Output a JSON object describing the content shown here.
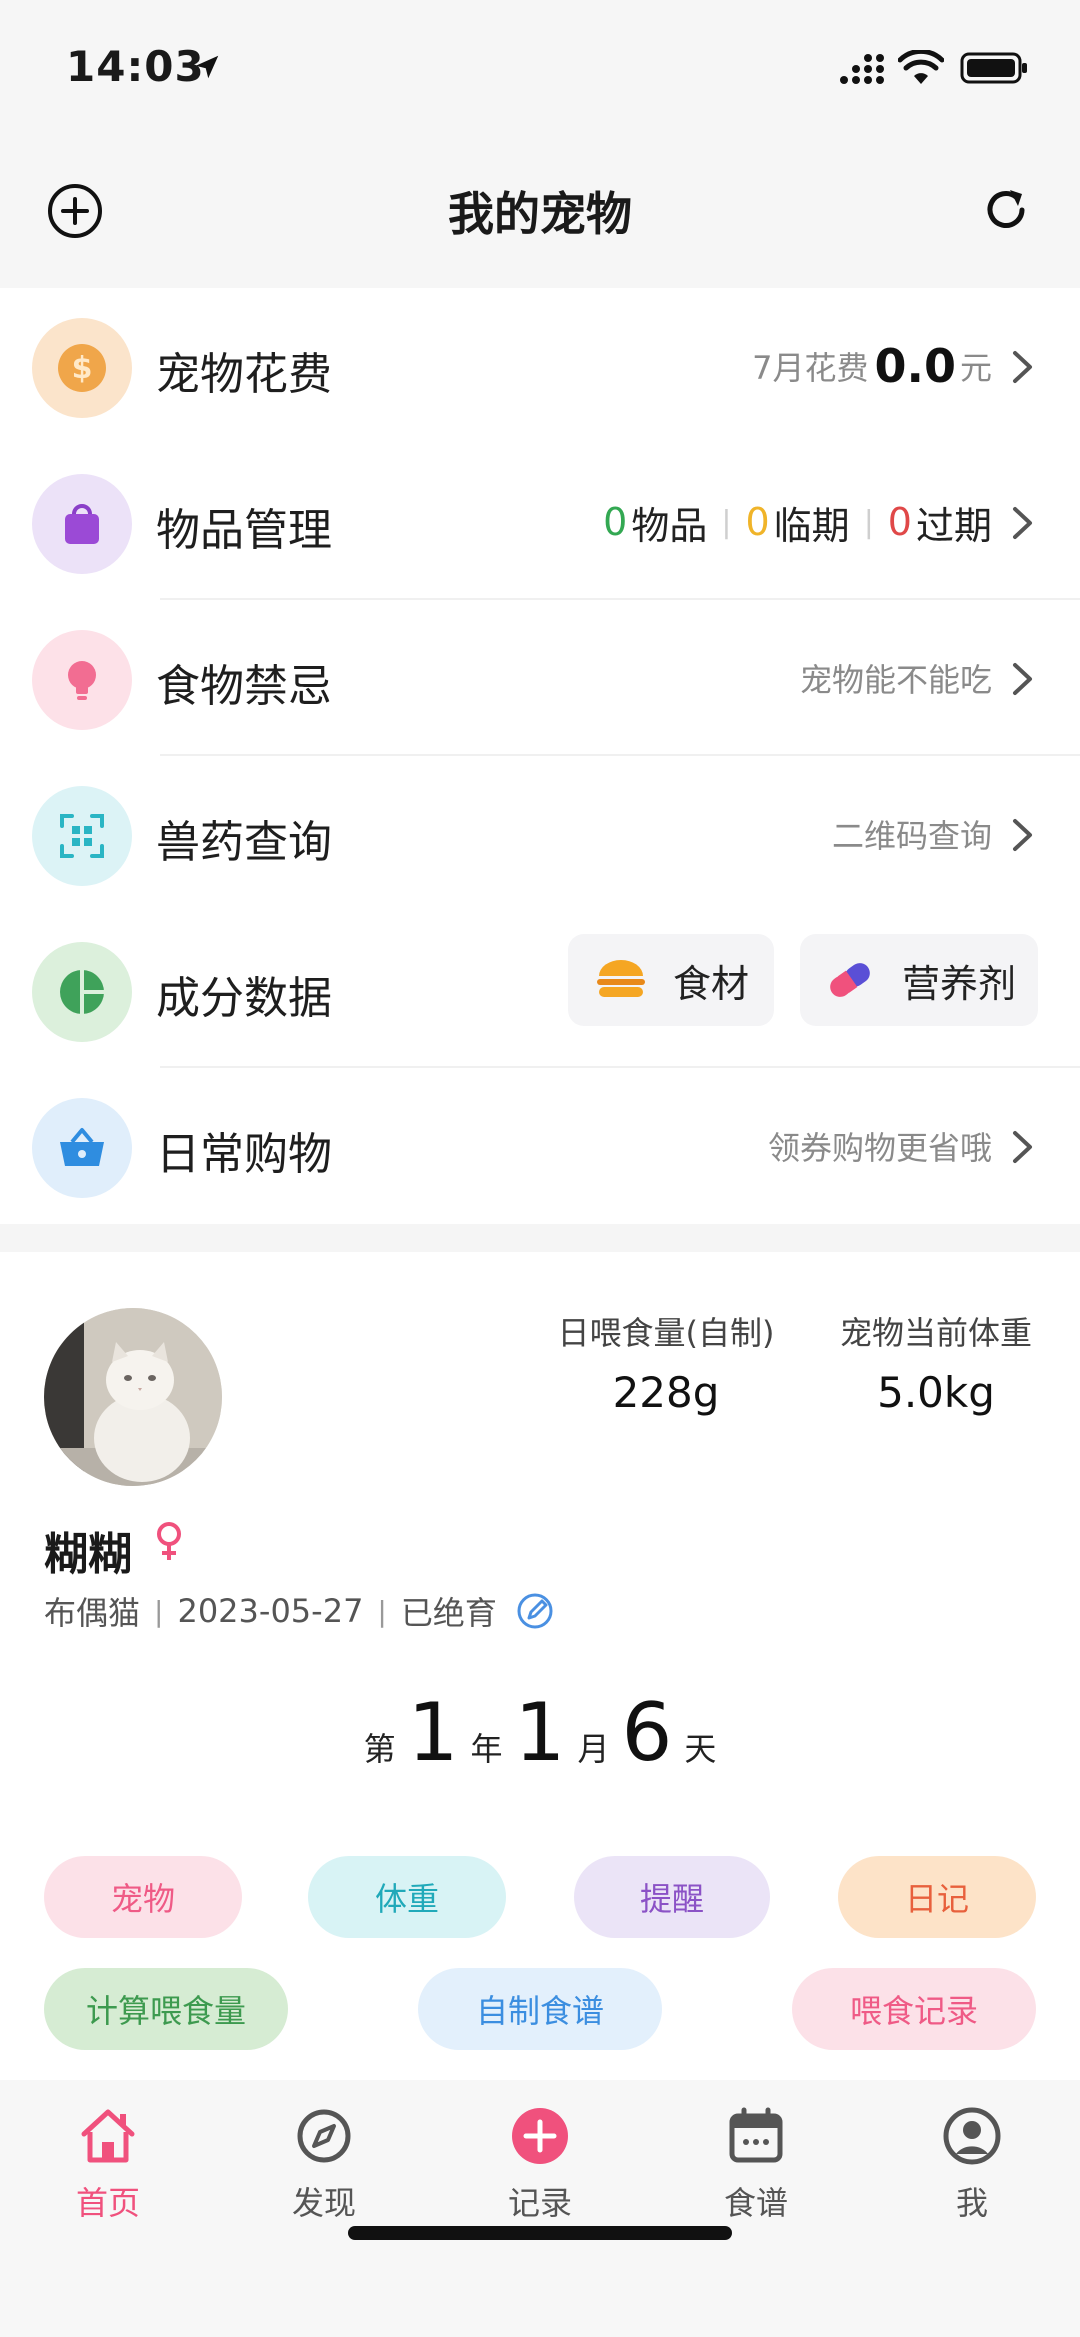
{
  "status_bar": {
    "time": "14:03"
  },
  "nav": {
    "title": "我的宠物"
  },
  "tools": {
    "expense": {
      "label": "宠物花费",
      "month_prefix": "7月花费",
      "value": "0.0",
      "unit": "元"
    },
    "items": {
      "label": "物品管理",
      "count_items": "0",
      "items_label": "物品",
      "count_expiring": "0",
      "expiring_label": "临期",
      "count_expired": "0",
      "expired_label": "过期"
    },
    "food_taboo": {
      "label": "食物禁忌",
      "hint": "宠物能不能吃"
    },
    "vet_drug": {
      "label": "兽药查询",
      "hint": "二维码查询"
    },
    "ingredients": {
      "label": "成分数据",
      "chip_food": "食材",
      "chip_supplement": "营养剂"
    },
    "shopping": {
      "label": "日常购物",
      "hint": "领券购物更省哦"
    }
  },
  "pet": {
    "daily_food_label": "日喂食量(自制)",
    "daily_food_value": "228g",
    "weight_label": "宠物当前体重",
    "weight_value": "5.0kg",
    "name": "糊糊",
    "breed": "布偶猫",
    "birthday": "2023-05-27",
    "neutered": "已绝育",
    "age": {
      "prefix": "第",
      "years": "1",
      "year_unit": "年",
      "months": "1",
      "month_unit": "月",
      "days": "6",
      "day_unit": "天"
    },
    "actions": [
      "宠物",
      "体重",
      "提醒",
      "日记",
      "计算喂食量",
      "自制食谱",
      "喂食记录"
    ]
  },
  "tabs": [
    "首页",
    "发现",
    "记录",
    "食谱",
    "我"
  ],
  "colors": {
    "accent": "#f0517d",
    "pill_pet": "#fce1e8",
    "pill_weight": "#d8f3f5",
    "pill_reminder": "#ebe4f7",
    "pill_diary": "#fde3c8",
    "pill_calc": "#d6ecd3",
    "pill_recipe": "#e3f0fc",
    "pill_record": "#fce1e8"
  }
}
